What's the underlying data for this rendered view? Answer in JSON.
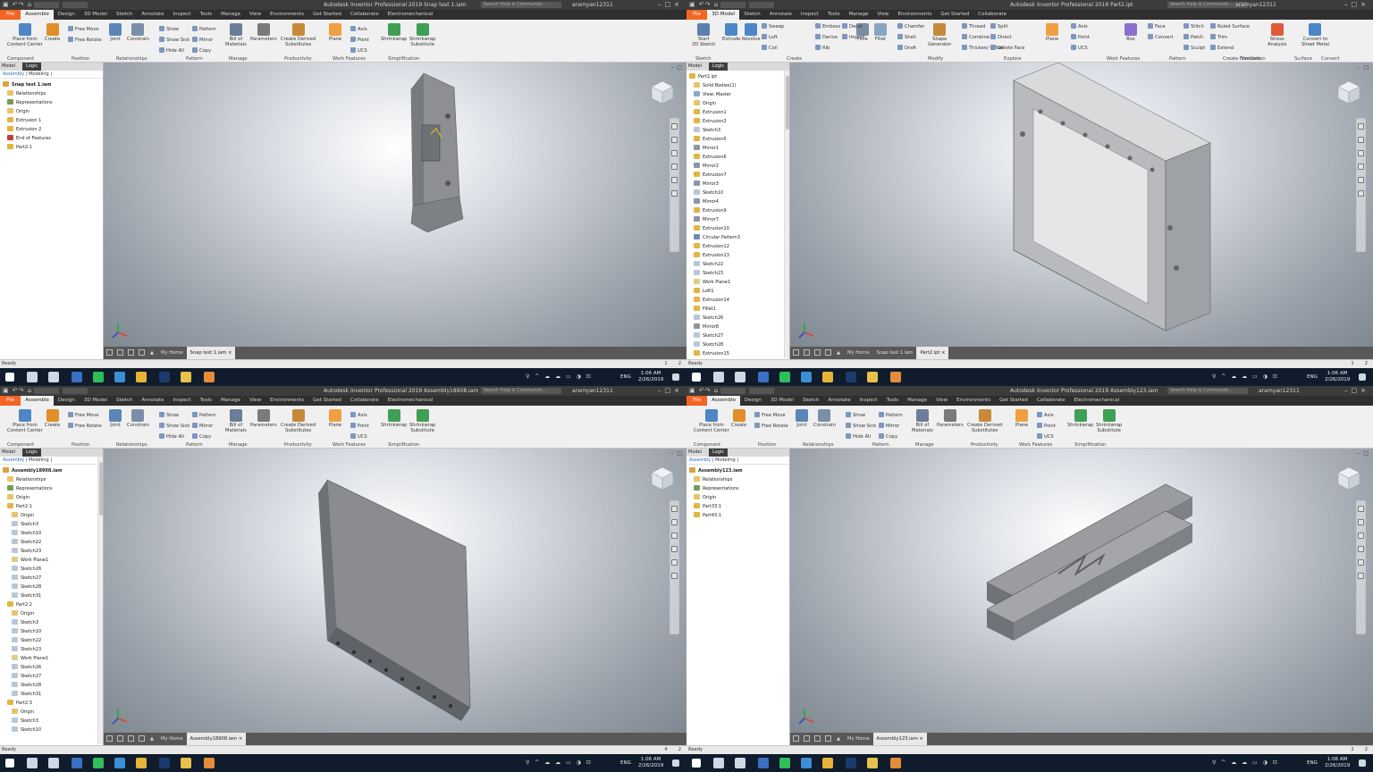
{
  "app": {
    "name": "Autodesk Inventor Professional 2019",
    "user": "aramyan12311",
    "search_placeholder": "Search Help & Commands..."
  },
  "system": {
    "time": "1:06 AM",
    "date": "2/26/2019",
    "lang": "ENG"
  },
  "colors": {
    "file_tab": "#f26522",
    "taskbar": "#101c2b",
    "viewport_center": "#ffffff",
    "viewport_edge": "#7f8791",
    "model_gray": "#8d8f93"
  },
  "quadrants": [
    {
      "title": "Snap test 1.iam",
      "tabs": [
        "File",
        "Assemble",
        "Design",
        "3D Model",
        "Sketch",
        "Annotate",
        "Inspect",
        "Tools",
        "Manage",
        "View",
        "Environments",
        "Get Started",
        "Collaborate",
        "Electromechanical"
      ],
      "active_tab": "Assemble",
      "browser_header": "Model",
      "browser_mode": "Logic",
      "browser_subtabs": [
        "Assembly",
        "Modeling"
      ],
      "tree": [
        {
          "label": "Snap test 1.iam",
          "icon": "assembly-icon",
          "indent": 0,
          "bold": true
        },
        {
          "label": "Relationships",
          "icon": "folder-icon",
          "indent": 1
        },
        {
          "label": "Representations",
          "icon": "representations-icon",
          "indent": 1
        },
        {
          "label": "Origin",
          "icon": "folder-icon",
          "indent": 1
        },
        {
          "label": "Extrusion 1",
          "icon": "extrusion-icon",
          "indent": 1
        },
        {
          "label": "Extrusion 2",
          "icon": "extrusion-icon",
          "indent": 1
        },
        {
          "label": "End of Features",
          "icon": "end-of-features-icon",
          "indent": 1
        },
        {
          "label": "Part2:1",
          "icon": "part-icon",
          "indent": 1
        }
      ],
      "doc_tabs": [
        "My Home",
        "Snap test 1.iam"
      ],
      "status": "Ready",
      "status_nums": [
        "1",
        "2"
      ]
    },
    {
      "title": "Part2.ipt",
      "tabs": [
        "File",
        "3D Model",
        "Sketch",
        "Annotate",
        "Inspect",
        "Tools",
        "Manage",
        "View",
        "Environments",
        "Get Started",
        "Collaborate"
      ],
      "active_tab": "3D Model",
      "browser_header": "Model",
      "browser_mode": "Logic",
      "browser_subtabs": [],
      "tree": [
        {
          "label": "Part2.ipt",
          "icon": "part-icon",
          "indent": 0
        },
        {
          "label": "Solid Bodies(1)",
          "icon": "folder-icon",
          "indent": 1
        },
        {
          "label": "View: Master",
          "icon": "view-icon",
          "indent": 1
        },
        {
          "label": "Origin",
          "icon": "folder-icon",
          "indent": 1
        },
        {
          "label": "Extrusion1",
          "icon": "extrusion-icon",
          "indent": 1
        },
        {
          "label": "Extrusion2",
          "icon": "extrusion-icon",
          "indent": 1
        },
        {
          "label": "Sketch3",
          "icon": "sketch-icon",
          "indent": 1
        },
        {
          "label": "Extrusion5",
          "icon": "extrusion-icon",
          "indent": 1
        },
        {
          "label": "Mirror1",
          "icon": "mirror-icon",
          "indent": 1
        },
        {
          "label": "Extrusion6",
          "icon": "extrusion-icon",
          "indent": 1
        },
        {
          "label": "Mirror2",
          "icon": "mirror-icon",
          "indent": 1
        },
        {
          "label": "Extrusion7",
          "icon": "extrusion-icon",
          "indent": 1
        },
        {
          "label": "Mirror3",
          "icon": "mirror-icon",
          "indent": 1
        },
        {
          "label": "Sketch10",
          "icon": "sketch-icon",
          "indent": 1
        },
        {
          "label": "Mirror4",
          "icon": "mirror-icon",
          "indent": 1
        },
        {
          "label": "Extrusion9",
          "icon": "extrusion-icon",
          "indent": 1
        },
        {
          "label": "Mirror7",
          "icon": "mirror-icon",
          "indent": 1
        },
        {
          "label": "Extrusion10",
          "icon": "extrusion-icon",
          "indent": 1
        },
        {
          "label": "Circular Pattern3",
          "icon": "pattern-icon",
          "indent": 1
        },
        {
          "label": "Extrusion12",
          "icon": "extrusion-icon",
          "indent": 1
        },
        {
          "label": "Extrusion13",
          "icon": "extrusion-icon",
          "indent": 1
        },
        {
          "label": "Sketch22",
          "icon": "sketch-icon",
          "indent": 1
        },
        {
          "label": "Sketch23",
          "icon": "sketch-icon",
          "indent": 1
        },
        {
          "label": "Work Plane1",
          "icon": "workplane-icon",
          "indent": 1
        },
        {
          "label": "Loft1",
          "icon": "loft-icon",
          "indent": 1
        },
        {
          "label": "Extrusion14",
          "icon": "extrusion-icon",
          "indent": 1
        },
        {
          "label": "Fillet1",
          "icon": "fillet-icon",
          "indent": 1
        },
        {
          "label": "Sketch26",
          "icon": "sketch-icon",
          "indent": 1
        },
        {
          "label": "Mirror8",
          "icon": "mirror-icon",
          "indent": 1
        },
        {
          "label": "Sketch27",
          "icon": "sketch-icon",
          "indent": 1
        },
        {
          "label": "Sketch28",
          "icon": "sketch-icon",
          "indent": 1
        },
        {
          "label": "Extrusion15",
          "icon": "extrusion-icon",
          "indent": 1
        }
      ],
      "doc_tabs": [
        "My Home",
        "Snap test 1.iam",
        "Part2.ipt"
      ],
      "status": "Ready",
      "status_nums": [
        "1",
        "2"
      ]
    },
    {
      "title": "Assembly18908.iam",
      "tabs": [
        "File",
        "Assemble",
        "Design",
        "3D Model",
        "Sketch",
        "Annotate",
        "Inspect",
        "Tools",
        "Manage",
        "View",
        "Environments",
        "Get Started",
        "Collaborate",
        "Electromechanical"
      ],
      "active_tab": "Assemble",
      "browser_header": "Model",
      "browser_mode": "Logic",
      "browser_subtabs": [
        "Assembly",
        "Modeling"
      ],
      "tree": [
        {
          "label": "Assembly18908.iam",
          "icon": "assembly-icon",
          "indent": 0,
          "bold": true
        },
        {
          "label": "Relationships",
          "icon": "folder-icon",
          "indent": 1
        },
        {
          "label": "Representations",
          "icon": "representations-icon",
          "indent": 1
        },
        {
          "label": "Origin",
          "icon": "folder-icon",
          "indent": 1
        },
        {
          "label": "Part2:1",
          "icon": "part-icon",
          "indent": 1
        },
        {
          "label": "Origin",
          "icon": "folder-icon",
          "indent": 2
        },
        {
          "label": "Sketch3",
          "icon": "sketch-icon",
          "indent": 2
        },
        {
          "label": "Sketch10",
          "icon": "sketch-icon",
          "indent": 2
        },
        {
          "label": "Sketch22",
          "icon": "sketch-icon",
          "indent": 2
        },
        {
          "label": "Sketch23",
          "icon": "sketch-icon",
          "indent": 2
        },
        {
          "label": "Work Plane1",
          "icon": "workplane-icon",
          "indent": 2
        },
        {
          "label": "Sketch26",
          "icon": "sketch-icon",
          "indent": 2
        },
        {
          "label": "Sketch27",
          "icon": "sketch-icon",
          "indent": 2
        },
        {
          "label": "Sketch28",
          "icon": "sketch-icon",
          "indent": 2
        },
        {
          "label": "Sketch31",
          "icon": "sketch-icon",
          "indent": 2
        },
        {
          "label": "Part2:2",
          "icon": "part-icon",
          "indent": 1
        },
        {
          "label": "Origin",
          "icon": "folder-icon",
          "indent": 2
        },
        {
          "label": "Sketch3",
          "icon": "sketch-icon",
          "indent": 2
        },
        {
          "label": "Sketch10",
          "icon": "sketch-icon",
          "indent": 2
        },
        {
          "label": "Sketch22",
          "icon": "sketch-icon",
          "indent": 2
        },
        {
          "label": "Sketch23",
          "icon": "sketch-icon",
          "indent": 2
        },
        {
          "label": "Work Plane1",
          "icon": "workplane-icon",
          "indent": 2
        },
        {
          "label": "Sketch26",
          "icon": "sketch-icon",
          "indent": 2
        },
        {
          "label": "Sketch27",
          "icon": "sketch-icon",
          "indent": 2
        },
        {
          "label": "Sketch28",
          "icon": "sketch-icon",
          "indent": 2
        },
        {
          "label": "Sketch31",
          "icon": "sketch-icon",
          "indent": 2
        },
        {
          "label": "Part2:3",
          "icon": "part-icon",
          "indent": 1
        },
        {
          "label": "Origin",
          "icon": "folder-icon",
          "indent": 2
        },
        {
          "label": "Sketch3",
          "icon": "sketch-icon",
          "indent": 2
        },
        {
          "label": "Sketch10",
          "icon": "sketch-icon",
          "indent": 2
        }
      ],
      "doc_tabs": [
        "My Home",
        "Assembly18908.iam"
      ],
      "status": "Ready",
      "status_nums": [
        "4",
        "2"
      ]
    },
    {
      "title": "Assembly123.iam",
      "tabs": [
        "File",
        "Assemble",
        "Design",
        "3D Model",
        "Sketch",
        "Annotate",
        "Inspect",
        "Tools",
        "Manage",
        "View",
        "Environments",
        "Get Started",
        "Collaborate",
        "Electromechanical"
      ],
      "active_tab": "Assemble",
      "browser_header": "Model",
      "browser_mode": "Logic",
      "browser_subtabs": [
        "Assembly",
        "Modeling"
      ],
      "tree": [
        {
          "label": "Assembly123.iam",
          "icon": "assembly-icon",
          "indent": 0,
          "bold": true
        },
        {
          "label": "Relationships",
          "icon": "folder-icon",
          "indent": 1
        },
        {
          "label": "Representations",
          "icon": "representations-icon",
          "indent": 1
        },
        {
          "label": "Origin",
          "icon": "folder-icon",
          "indent": 1
        },
        {
          "label": "Part33:1",
          "icon": "part-icon",
          "indent": 1
        },
        {
          "label": "Part43:1",
          "icon": "part-icon",
          "indent": 1
        }
      ],
      "doc_tabs": [
        "My Home",
        "Assembly123.iam"
      ],
      "status": "Ready",
      "status_nums": [
        "2",
        "2"
      ]
    }
  ],
  "ribbon_assemble": {
    "buttons": [
      {
        "label": "Place from\nContent Center",
        "icon": "place-icon"
      },
      {
        "label": "Create",
        "icon": "create-icon"
      },
      {
        "label": "Joint",
        "icon": "joint-icon"
      },
      {
        "label": "Constrain",
        "icon": "constrain-icon"
      },
      {
        "label": "Bill of\nMaterials",
        "icon": "bom-icon"
      },
      {
        "label": "Parameters",
        "icon": "parameters-icon"
      },
      {
        "label": "Create Derived\nSubstitutes",
        "icon": "derived-icon"
      },
      {
        "label": "Plane",
        "icon": "plane-icon"
      },
      {
        "label": "Shrinkwrap",
        "icon": "shrinkwrap-icon"
      },
      {
        "label": "Shrinkwrap\nSubstitute",
        "icon": "shrinkwrap-sub-icon"
      }
    ],
    "small": [
      "Free Move",
      "Free Rotate",
      "Show",
      "Show Sick",
      "Hide All",
      "Pattern",
      "Mirror",
      "Copy",
      "Axis",
      "Point",
      "UCS"
    ],
    "groups": [
      "Component",
      "Position",
      "Relationships",
      "Pattern",
      "Manage",
      "Productivity",
      "Work Features",
      "Simplification"
    ]
  },
  "ribbon_part": {
    "buttons": [
      {
        "label": "Start\n2D Sketch",
        "icon": "sketch2d-icon"
      },
      {
        "label": "Extrude",
        "icon": "extrude-icon"
      },
      {
        "label": "Revolve",
        "icon": "revolve-icon"
      },
      {
        "label": "Hole",
        "icon": "hole-icon"
      },
      {
        "label": "Fillet",
        "icon": "fillet-icon"
      },
      {
        "label": "Shape\nGenerator",
        "icon": "shape-icon"
      },
      {
        "label": "Plane",
        "icon": "plane-icon"
      },
      {
        "label": "Box",
        "icon": "box-icon"
      },
      {
        "label": "Stress\nAnalysis",
        "icon": "stress-icon"
      },
      {
        "label": "Convert to\nSheet Metal",
        "icon": "sheetmetal-icon"
      }
    ],
    "small": [
      "Sweep",
      "Emboss",
      "Decal",
      "Loft",
      "Derive",
      "Import",
      "Coil",
      "Rib",
      "Chamfer",
      "Shell",
      "Draft",
      "Thread",
      "Combine",
      "Thicken/ Offset",
      "Split",
      "Direct",
      "Delete Face",
      "Axis",
      "Point",
      "UCS",
      "Face",
      "Convert",
      "Stitch",
      "Patch",
      "Sculpt",
      "Ruled Surface",
      "Trim",
      "Extend"
    ],
    "groups": [
      "Sketch",
      "Create",
      "Modify",
      "Explore",
      "Work Features",
      "Pattern",
      "Create Freeform",
      "Surface",
      "Simulation",
      "Convert"
    ]
  }
}
